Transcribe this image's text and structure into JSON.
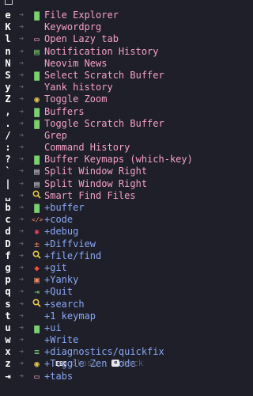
{
  "colors": {
    "background": "#1e1f29",
    "key": "#ffffff",
    "arrow": "#5a5f73",
    "action": "#f6a0c8",
    "group": "#8aa7f5",
    "footer_dim": "#545868"
  },
  "items": [
    {
      "key": "e",
      "icon": "file-icon",
      "glyph": "▇",
      "icon_color": "#79d26b",
      "label": "File Explorer",
      "type": "action"
    },
    {
      "key": "K",
      "icon": "none",
      "glyph": "",
      "icon_color": "#f6a0c8",
      "label": "Keywordprg",
      "type": "action"
    },
    {
      "key": "l",
      "icon": "window-icon",
      "glyph": "▭",
      "icon_color": "#f6a0c8",
      "label": "Open Lazy tab",
      "type": "action"
    },
    {
      "key": "n",
      "icon": "notification-icon",
      "glyph": "▤",
      "icon_color": "#79d26b",
      "label": "Notification History",
      "type": "action"
    },
    {
      "key": "N",
      "icon": "none",
      "glyph": "",
      "icon_color": "#f6a0c8",
      "label": "Neovim News",
      "type": "action"
    },
    {
      "key": "S",
      "icon": "file-icon",
      "glyph": "▇",
      "icon_color": "#79d26b",
      "label": "Select Scratch Buffer",
      "type": "action"
    },
    {
      "key": "y",
      "icon": "none",
      "glyph": "",
      "icon_color": "#f6a0c8",
      "label": "Yank history",
      "type": "action"
    },
    {
      "key": "Z",
      "icon": "toggle-icon",
      "glyph": "◉",
      "icon_color": "#e8c84a",
      "label": "Toggle Zoom",
      "type": "action"
    },
    {
      "key": ",",
      "icon": "file-icon",
      "glyph": "▇",
      "icon_color": "#79d26b",
      "label": "Buffers",
      "type": "action"
    },
    {
      "key": ".",
      "icon": "file-icon",
      "glyph": "▇",
      "icon_color": "#79d26b",
      "label": "Toggle Scratch Buffer",
      "type": "action"
    },
    {
      "key": "/",
      "icon": "none",
      "glyph": "",
      "icon_color": "#f6a0c8",
      "label": "Grep",
      "type": "action"
    },
    {
      "key": ":",
      "icon": "none",
      "glyph": "",
      "icon_color": "#f6a0c8",
      "label": "Command History",
      "type": "action"
    },
    {
      "key": "?",
      "icon": "file-icon",
      "glyph": "▇",
      "icon_color": "#79d26b",
      "label": "Buffer Keymaps (which-key)",
      "type": "action"
    },
    {
      "key": "`",
      "icon": "split-window-icon",
      "glyph": "▤",
      "icon_color": "#c8c8d0",
      "label": "Split Window Right",
      "type": "action"
    },
    {
      "key": "|",
      "icon": "split-window-icon",
      "glyph": "▤",
      "icon_color": "#c8c8d0",
      "label": "Split Window Right",
      "type": "action"
    },
    {
      "key": "␣",
      "icon": "search-icon",
      "glyph": "🔍",
      "icon_color": "#e8c84a",
      "label": "Smart Find Files",
      "type": "action"
    },
    {
      "key": "b",
      "icon": "file-icon",
      "glyph": "▇",
      "icon_color": "#79d26b",
      "label": "+buffer",
      "type": "group"
    },
    {
      "key": "c",
      "icon": "code-icon",
      "glyph": "</>",
      "icon_color": "#f08a5d",
      "label": "+code",
      "type": "group"
    },
    {
      "key": "d",
      "icon": "bug-icon",
      "glyph": "✱",
      "icon_color": "#e0455a",
      "label": "+debug",
      "type": "group"
    },
    {
      "key": "D",
      "icon": "diff-icon",
      "glyph": "±",
      "icon_color": "#f08a5d",
      "label": "+Diffview",
      "type": "group"
    },
    {
      "key": "f",
      "icon": "search-icon",
      "glyph": "🔍",
      "icon_color": "#e8c84a",
      "label": "+file/find",
      "type": "group"
    },
    {
      "key": "g",
      "icon": "git-icon",
      "glyph": "◆",
      "icon_color": "#f05133",
      "label": "+git",
      "type": "group"
    },
    {
      "key": "p",
      "icon": "clipboard-icon",
      "glyph": "▣",
      "icon_color": "#f08a5d",
      "label": "+Yanky",
      "type": "group"
    },
    {
      "key": "q",
      "icon": "quit-icon",
      "glyph": "⇥",
      "icon_color": "#79d26b",
      "label": "+Quit",
      "type": "group"
    },
    {
      "key": "s",
      "icon": "search-icon",
      "glyph": "🔍",
      "icon_color": "#e8c84a",
      "label": "+search",
      "type": "group"
    },
    {
      "key": "t",
      "icon": "none",
      "glyph": "",
      "icon_color": "#8aa7f5",
      "label": "+1 keymap",
      "type": "group"
    },
    {
      "key": "u",
      "icon": "ui-icon",
      "glyph": "▆",
      "icon_color": "#79d26b",
      "label": "+ui",
      "type": "group"
    },
    {
      "key": "w",
      "icon": "none",
      "glyph": "",
      "icon_color": "#8aa7f5",
      "label": "+Write",
      "type": "group"
    },
    {
      "key": "x",
      "icon": "diagnostics-icon",
      "glyph": "≡",
      "icon_color": "#79d26b",
      "label": "+diagnostics/quickfix",
      "type": "group"
    },
    {
      "key": "z",
      "icon": "toggle-icon",
      "glyph": "◉",
      "icon_color": "#e8c84a",
      "label": "+Toggle Zen Mode",
      "type": "group"
    },
    {
      "key": "⇥",
      "icon": "tabs-icon",
      "glyph": "▭",
      "icon_color": "#f6a0c8",
      "label": "+tabs",
      "type": "group"
    }
  ],
  "footer": {
    "close_key": "ESC",
    "close_label": "close",
    "back_key": "⌫",
    "back_label": "back"
  }
}
